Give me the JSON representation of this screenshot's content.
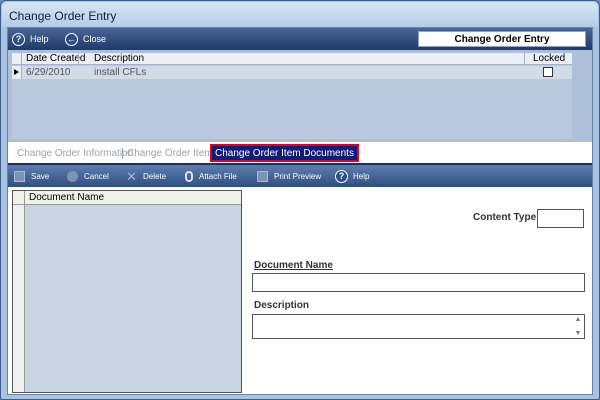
{
  "window": {
    "title": "Change Order Entry"
  },
  "toolbar": {
    "help_label": "Help",
    "close_label": "Close",
    "panel_title": "Change Order Entry"
  },
  "grid": {
    "columns": [
      "Date Created",
      "Description",
      "Locked"
    ],
    "rows": [
      {
        "date_created": "6/29/2010",
        "description": "install CFLs",
        "locked": false
      }
    ]
  },
  "tabs": [
    {
      "label": "Change Order Information",
      "active": false
    },
    {
      "label": "Change Order Items",
      "active": false
    },
    {
      "label": "Change Order Item Documents",
      "active": true
    }
  ],
  "doc_toolbar": {
    "save_label": "Save",
    "cancel_label": "Cancel",
    "delete_label": "Delete",
    "attach_label": "Attach File",
    "print_label": "Print Preview",
    "help_label": "Help"
  },
  "documents_list": {
    "column": "Document Name",
    "items": []
  },
  "form": {
    "content_type_label": "Content Type",
    "content_type_value": "",
    "document_name_label": "Document Name",
    "document_name_value": "",
    "description_label": "Description",
    "description_value": ""
  },
  "colors": {
    "toolbar": "#2a4577",
    "active_tab_bg": "#101c78",
    "active_tab_border": "#e00022",
    "window_frame": "#a9c3e3"
  }
}
